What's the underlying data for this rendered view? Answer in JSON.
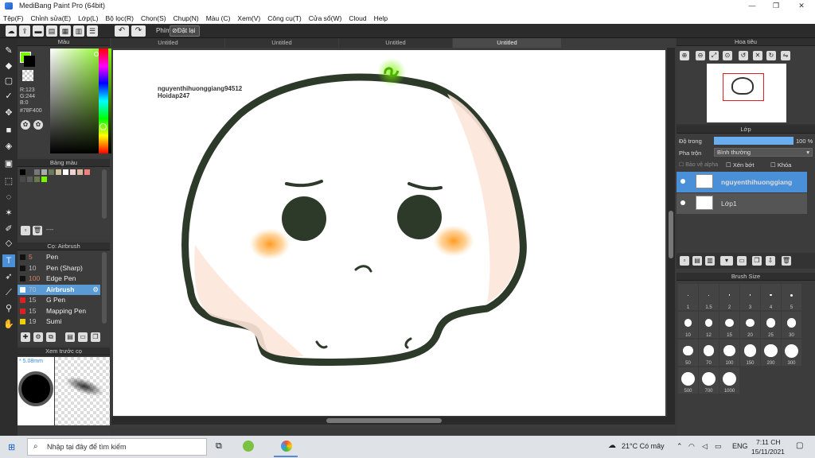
{
  "window": {
    "title": "MediBang Paint Pro (64bit)",
    "minimize": "—",
    "maximize": "❐",
    "close": "✕"
  },
  "menu": [
    "Tệp(F)",
    "Chỉnh sửa(E)",
    "Lớp(L)",
    "Bộ lọc(R)",
    "Chọn(S)",
    "Chụp(N)",
    "Màu (C)",
    "Xem(V)",
    "Công cụ(T)",
    "Cửa sổ(W)",
    "Cloud",
    "Help"
  ],
  "toolbar": {
    "shortcut_label": "Phím",
    "reset_label": "Đặt lại"
  },
  "color_panel": {
    "title": "Màu",
    "fg_color": "#78F400",
    "r": "R:123",
    "g": "G:244",
    "b": "B:0",
    "hex": "#78F400"
  },
  "swatch_panel": {
    "title": "Bảng màu",
    "colors": [
      "#000000",
      "#3a3a3a",
      "#777777",
      "#aaaaaa",
      "#6a7a5a",
      "#d0c0a0",
      "#ffffff",
      "#f0d0d0",
      "#d9b7a0",
      "#f08080",
      "#4a4a4a",
      "#5a5a5a",
      "#6a7a4a",
      "#78f400"
    ],
    "preset": "----"
  },
  "brush_panel": {
    "title": "Cọ: Airbrush",
    "items": [
      {
        "size": "5",
        "name": "Pen",
        "color": "#111111"
      },
      {
        "size": "10",
        "name": "Pen (Sharp)",
        "color": "#111111"
      },
      {
        "size": "100",
        "name": "Edge Pen",
        "color": "#111111"
      },
      {
        "size": "70",
        "name": "Airbrush",
        "color": "#ffffff"
      },
      {
        "size": "15",
        "name": "G Pen",
        "color": "#e02020"
      },
      {
        "size": "15",
        "name": "Mapping Pen",
        "color": "#e02020"
      },
      {
        "size": "19",
        "name": "Sumi",
        "color": "#f0d000"
      }
    ]
  },
  "preview_panel": {
    "title": "Xem trước cọ",
    "size": "5.08mm"
  },
  "tabs": [
    "Untitled",
    "Untitled",
    "Untitled",
    "Untitled"
  ],
  "canvas": {
    "watermark_line1": "nguyenthihuonggiang94512",
    "watermark_line2": "Hoidap247"
  },
  "navigator": {
    "title": "Hoa tiêu"
  },
  "layer_panel": {
    "title": "Lớp",
    "opacity_label": "Độ trong",
    "opacity_value": "100 %",
    "opacity_fraction": 1.0,
    "blend_label": "Pha trộn",
    "blend_value": "Bình thường",
    "protect_alpha": "Bảo vệ alpha",
    "clipping": "Xén bớt",
    "lock": "Khóa",
    "layers": [
      {
        "name": "nguyenthihuonggiang",
        "selected": true
      },
      {
        "name": "Lớp1",
        "selected": false
      }
    ]
  },
  "brush_size_panel": {
    "title": "Brush Size",
    "sizes": [
      "1",
      "1.5",
      "2",
      "3",
      "4",
      "5",
      "10",
      "12",
      "15",
      "20",
      "25",
      "30",
      "50",
      "70",
      "100",
      "150",
      "200",
      "300",
      "500",
      "700",
      "1000"
    ]
  },
  "taskbar": {
    "search_placeholder": "Nhập tại đây để tìm kiếm",
    "weather": "21°C Có mây",
    "lang": "ENG",
    "time": "7:11 CH",
    "date": "15/11/2021"
  }
}
